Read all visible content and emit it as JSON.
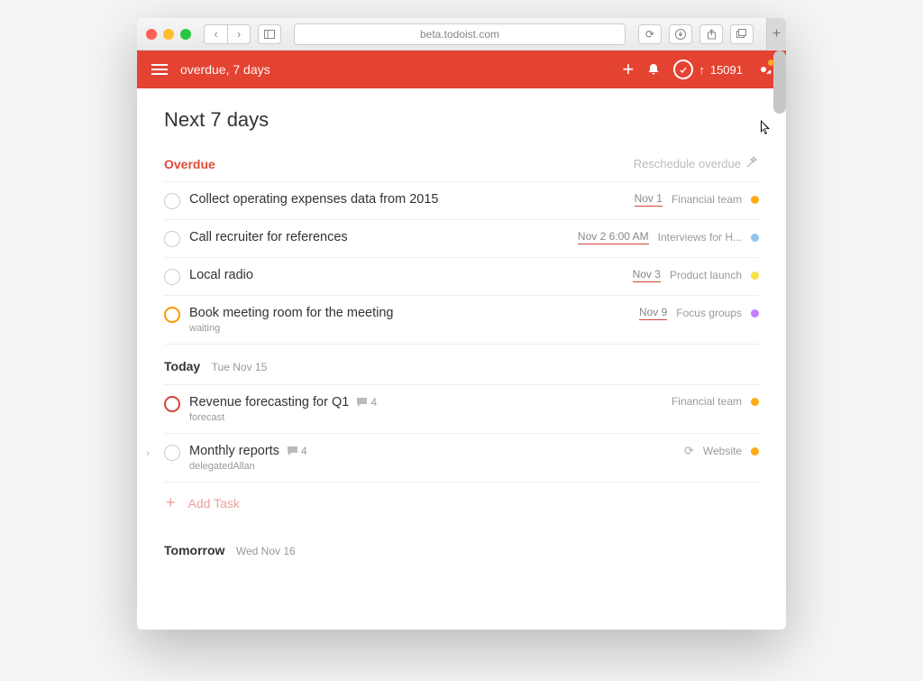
{
  "browser": {
    "url": "beta.todoist.com"
  },
  "header": {
    "breadcrumb": "overdue, 7 days",
    "karma_arrow": "↑",
    "karma": "15091"
  },
  "page": {
    "title": "Next 7 days"
  },
  "sections": {
    "overdue": {
      "title": "Overdue",
      "reschedule": "Reschedule overdue",
      "tasks": [
        {
          "title": "Collect operating expenses data from 2015",
          "due": "Nov 1",
          "project": "Financial team",
          "dot": "orange",
          "priority": "",
          "sub": ""
        },
        {
          "title": "Call recruiter for references",
          "due": "Nov 2 6:00 AM",
          "project": "Interviews for H...",
          "dot": "blue",
          "priority": "",
          "sub": ""
        },
        {
          "title": "Local radio",
          "due": "Nov 3",
          "project": "Product launch",
          "dot": "yellow",
          "priority": "",
          "sub": ""
        },
        {
          "title": "Book meeting room for the meeting",
          "due": "Nov 9",
          "project": "Focus groups",
          "dot": "purple",
          "priority": "p2",
          "sub": "waiting"
        }
      ]
    },
    "today": {
      "title": "Today",
      "subtitle": "Tue Nov 15",
      "tasks": [
        {
          "title": "Revenue forecasting for Q1",
          "comments": "4",
          "project": "Financial team",
          "dot": "orange",
          "priority": "p1",
          "sub": "forecast"
        },
        {
          "title": "Monthly reports",
          "comments": "4",
          "project": "Website",
          "dot": "orange",
          "priority": "",
          "sub": "delegatedAllan",
          "sync": true,
          "expandable": true
        }
      ],
      "add_task": "Add Task"
    },
    "tomorrow": {
      "title": "Tomorrow",
      "subtitle": "Wed Nov 16"
    }
  }
}
